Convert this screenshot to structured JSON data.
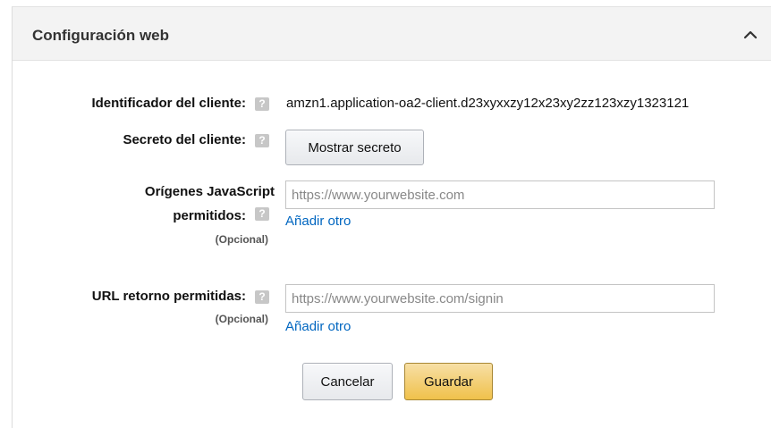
{
  "panel": {
    "title": "Configuración web",
    "collapse_icon": "chevron-up-icon"
  },
  "fields": {
    "client_id": {
      "label": "Identificador del cliente:",
      "value": "amzn1.application-oa2-client.d23xyxxzy12x23xy2zz123xzy1323121"
    },
    "client_secret": {
      "label": "Secreto del cliente:",
      "button_label": "Mostrar secreto"
    },
    "js_origins": {
      "label_line1": "Orígenes JavaScript",
      "label_line2": "permitidos:",
      "optional": "(Opcional)",
      "placeholder": "https://www.yourwebsite.com",
      "add_link": "Añadir otro"
    },
    "return_urls": {
      "label": "URL retorno permitidas:",
      "optional": "(Opcional)",
      "placeholder": "https://www.yourwebsite.com/signin",
      "add_link": "Añadir otro"
    }
  },
  "help_icon": {
    "glyph": "?",
    "name": "help-icon"
  },
  "actions": {
    "cancel_label": "Cancelar",
    "save_label": "Guardar"
  },
  "colors": {
    "link": "#0066c0",
    "primary_button": "#f0c14b",
    "help_icon_bg": "#c7c7c7"
  }
}
